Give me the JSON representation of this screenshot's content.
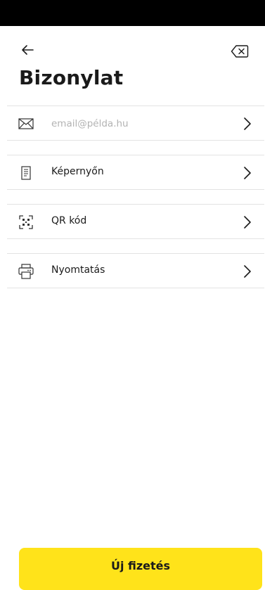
{
  "header": {
    "title": "Bizonylat",
    "back_icon": "arrow-left-icon",
    "clear_icon": "backspace-icon"
  },
  "options": [
    {
      "id": "email",
      "icon": "envelope-icon",
      "placeholder": "email@példa.hu",
      "value": ""
    },
    {
      "id": "screen",
      "icon": "receipt-icon",
      "label": "Képernyőn"
    },
    {
      "id": "qr",
      "icon": "qr-code-icon",
      "label": "QR kód"
    },
    {
      "id": "print",
      "icon": "printer-icon",
      "label": "Nyomtatás"
    }
  ],
  "footer": {
    "new_payment_label": "Új fizetés"
  },
  "colors": {
    "accent": "#ffe31a",
    "divider": "#e3e3e3",
    "placeholder": "#b3b3b3",
    "text": "#1a1a1a"
  }
}
